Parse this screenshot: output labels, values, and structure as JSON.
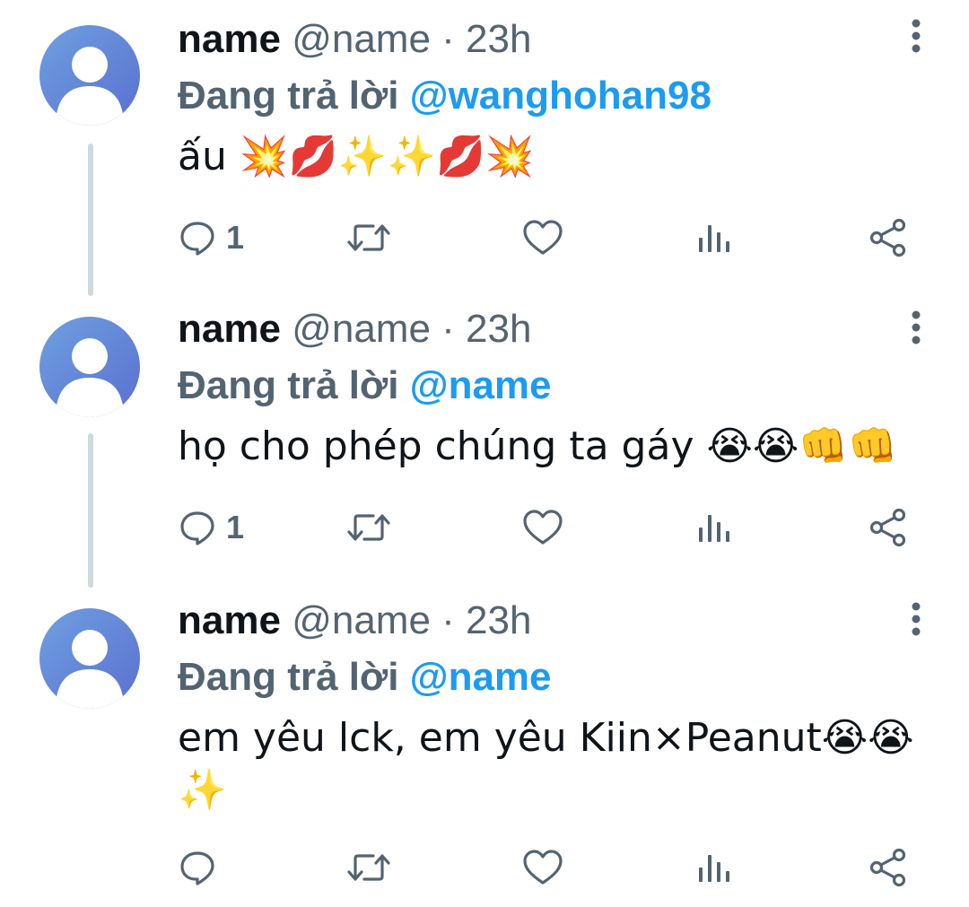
{
  "colors": {
    "text_primary": "#0f1419",
    "text_secondary": "#536471",
    "mention": "#1d9bf0",
    "thread_line": "#cfd9de",
    "avatar_gradient_start": "#6ea0e0",
    "avatar_gradient_end": "#5b6fd0"
  },
  "tweets": [
    {
      "name": "name",
      "handle": "@name",
      "dot": "·",
      "time": "23h",
      "reply_prefix": "Đang trả lời",
      "reply_to": "@wanghohan98",
      "text": "ấu 💥💋✨✨💋💥",
      "reply_count": "1",
      "icons": [
        "avatar-icon",
        "more-vertical-icon",
        "reply-icon",
        "retweet-icon",
        "like-icon",
        "analytics-icon",
        "share-icon"
      ]
    },
    {
      "name": "name",
      "handle": "@name",
      "dot": "·",
      "time": "23h",
      "reply_prefix": "Đang trả lời",
      "reply_to": "@name",
      "text": "họ cho phép chúng ta gáy 😭😭👊👊",
      "reply_count": "1",
      "icons": [
        "avatar-icon",
        "more-vertical-icon",
        "reply-icon",
        "retweet-icon",
        "like-icon",
        "analytics-icon",
        "share-icon"
      ]
    },
    {
      "name": "name",
      "handle": "@name",
      "dot": "·",
      "time": "23h",
      "reply_prefix": "Đang trả lời",
      "reply_to": "@name",
      "text": "em yêu lck, em yêu Kiin×Peanut😭😭✨",
      "reply_count": "",
      "icons": [
        "avatar-icon",
        "more-vertical-icon",
        "reply-icon",
        "retweet-icon",
        "like-icon",
        "analytics-icon",
        "share-icon"
      ]
    }
  ]
}
